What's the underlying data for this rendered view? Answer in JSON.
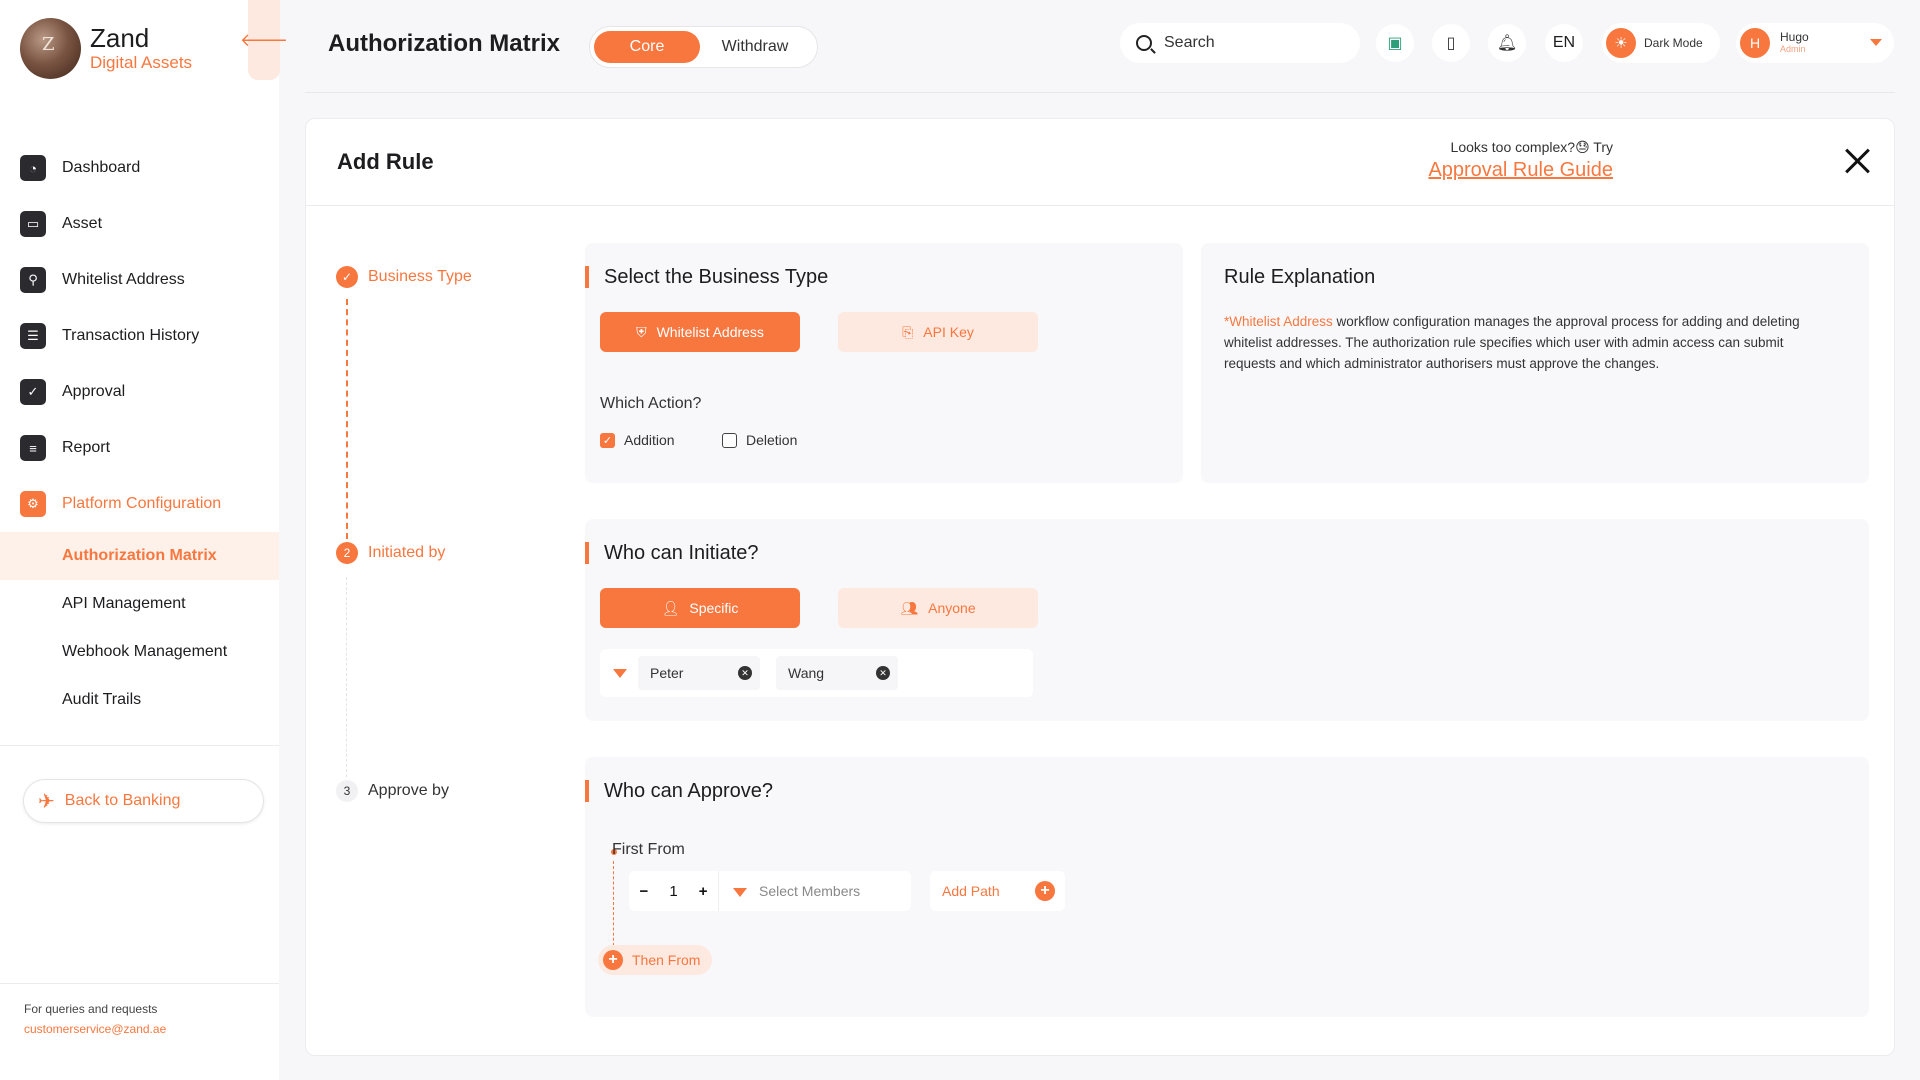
{
  "brand": {
    "name": "Zand",
    "subtitle": "Digital Assets",
    "collapse_icon": "arrow-left-icon"
  },
  "sidebar": {
    "items": [
      {
        "label": "Dashboard",
        "icon": "dashboard-icon"
      },
      {
        "label": "Asset",
        "icon": "wallet-icon"
      },
      {
        "label": "Whitelist Address",
        "icon": "location-pin-icon"
      },
      {
        "label": "Transaction History",
        "icon": "list-icon"
      },
      {
        "label": "Approval",
        "icon": "check-icon"
      },
      {
        "label": "Report",
        "icon": "report-icon"
      },
      {
        "label": "Platform Configuration",
        "icon": "settings-icon",
        "active": true
      }
    ],
    "sub_items": [
      {
        "label": "Authorization Matrix",
        "active": true
      },
      {
        "label": "API Management"
      },
      {
        "label": "Webhook Management"
      },
      {
        "label": "Audit Trails"
      }
    ],
    "back_button": "Back to Banking",
    "footer_text": "For queries and requests",
    "footer_email": "customerservice@zand.ae"
  },
  "header": {
    "title": "Authorization Matrix",
    "segments": [
      "Core",
      "Withdraw"
    ],
    "active_segment": "Core",
    "search_placeholder": "Search",
    "language": "EN",
    "dark_mode_label": "Dark Mode",
    "user": {
      "initial": "H",
      "name": "Hugo",
      "role": "Admin"
    }
  },
  "panel": {
    "title": "Add Rule",
    "guide_hint": "Looks too complex?😓 Try",
    "guide_link": "Approval Rule Guide",
    "steps": [
      {
        "label": "Business Type",
        "marker": "✓",
        "state": "done"
      },
      {
        "label": "Initiated by",
        "marker": "2",
        "state": "current"
      },
      {
        "label": "Approve by",
        "marker": "3",
        "state": "todo"
      }
    ],
    "business": {
      "heading": "Select the Business Type",
      "options": [
        {
          "label": "Whitelist Address",
          "icon": "shield-icon",
          "selected": true
        },
        {
          "label": "API Key",
          "icon": "key-document-icon",
          "selected": false
        }
      ],
      "action_label": "Which Action?",
      "actions": [
        {
          "label": "Addition",
          "checked": true
        },
        {
          "label": "Deletion",
          "checked": false
        }
      ]
    },
    "explanation": {
      "heading": "Rule Explanation",
      "highlight": "*Whitelist Address",
      "text": " workflow configuration manages the approval process for adding and deleting whitelist addresses. The authorization rule specifies which user with admin access can submit requests and which administrator authorisers must approve the changes."
    },
    "initiate": {
      "heading": "Who can Initiate?",
      "options": [
        {
          "label": "Specific",
          "icon": "user-icon",
          "selected": true
        },
        {
          "label": "Anyone",
          "icon": "users-icon",
          "selected": false
        }
      ],
      "members": [
        "Peter",
        "Wang"
      ]
    },
    "approve": {
      "heading": "Who can Approve?",
      "first_from": "First From",
      "count": "1",
      "select_placeholder": "Select Members",
      "add_path": "Add Path",
      "then_from": "Then From"
    }
  },
  "colors": {
    "accent": "#f7773f",
    "accent_light": "#fde9df"
  }
}
